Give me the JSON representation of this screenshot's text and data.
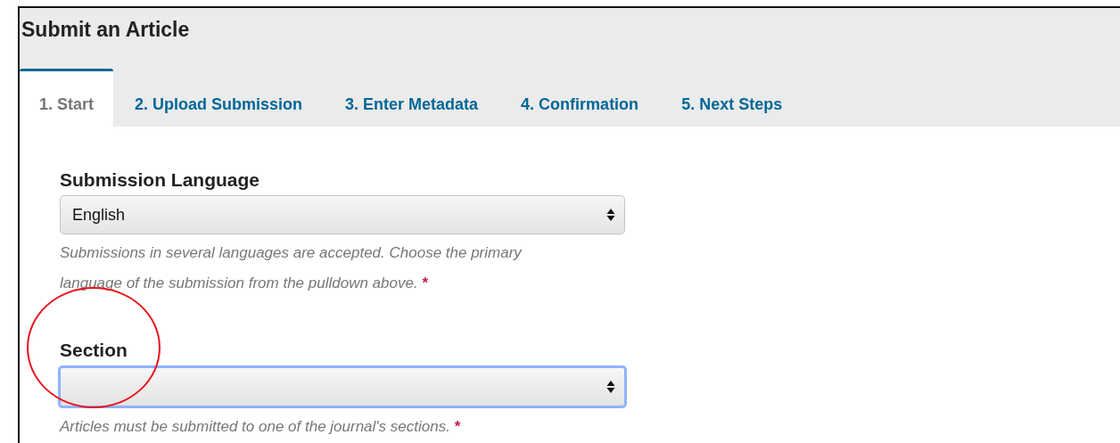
{
  "page": {
    "title": "Submit an Article"
  },
  "tabs": [
    {
      "label": "1. Start",
      "selected": true
    },
    {
      "label": "2. Upload Submission",
      "selected": false
    },
    {
      "label": "3. Enter Metadata",
      "selected": false
    },
    {
      "label": "4. Confirmation",
      "selected": false
    },
    {
      "label": "5. Next Steps",
      "selected": false
    }
  ],
  "fields": [
    {
      "label": "Submission Language",
      "value": "English",
      "focused": false,
      "help": "Submissions in several languages are accepted. Choose the primary language of the submission from the pulldown above.",
      "required_mark": "*"
    },
    {
      "label": "Section",
      "focused": true,
      "help": "Articles must be submitted to one of the journal's sections.",
      "required_mark": "*"
    }
  ]
}
